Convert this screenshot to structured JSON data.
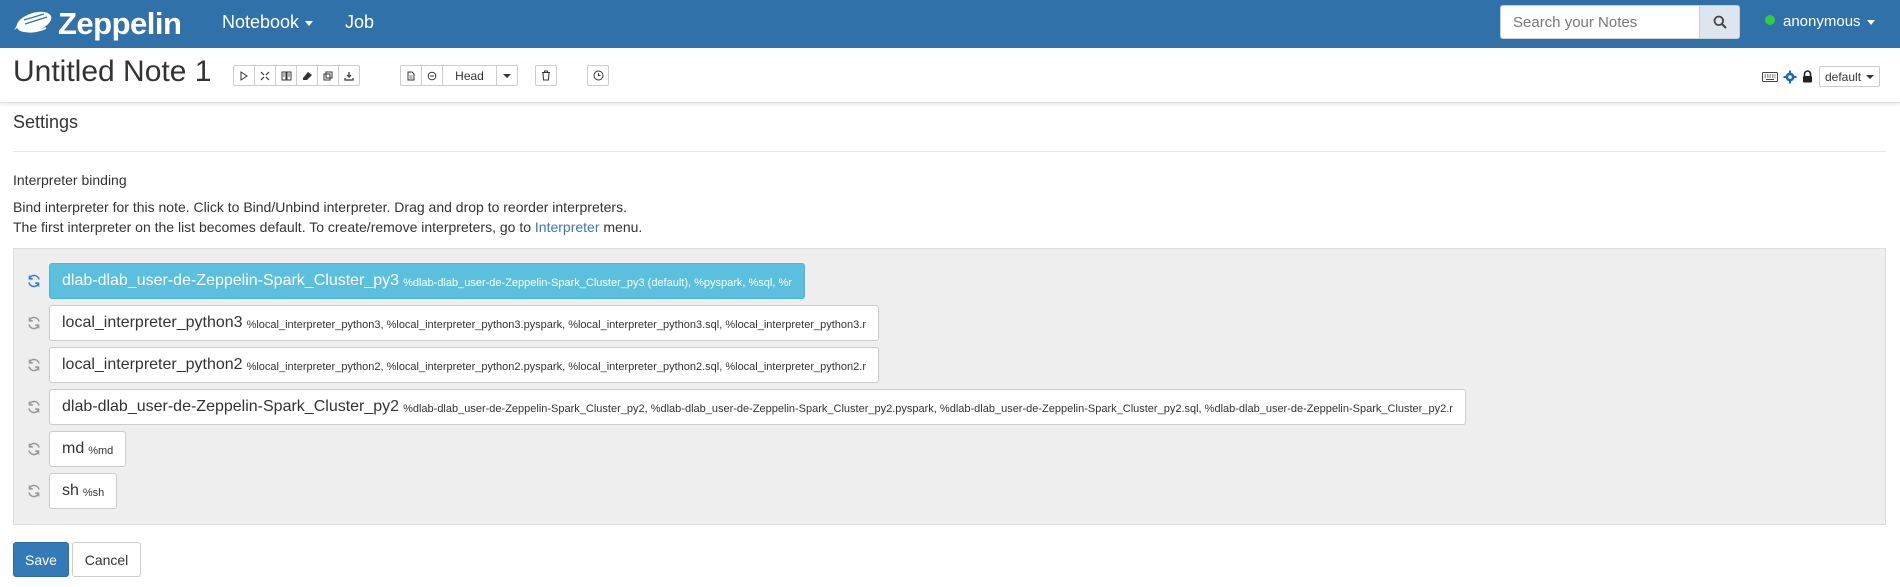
{
  "navbar": {
    "brand": "Zeppelin",
    "menu": [
      {
        "label": "Notebook",
        "has_dropdown": true
      },
      {
        "label": "Job",
        "has_dropdown": false
      }
    ],
    "search_placeholder": "Search your Notes",
    "user": "anonymous",
    "user_status_color": "#2ecc40",
    "bg_color": "#3071a9"
  },
  "note": {
    "title": "Untitled Note 1",
    "toolbar_icons": [
      "run-all-icon",
      "show-hide-code-icon",
      "show-hide-output-icon",
      "clear-output-icon",
      "clone-icon",
      "export-icon"
    ],
    "version_icons": [
      "commit-icon",
      "revision-compare-icon"
    ],
    "version_label": "Head",
    "delete_icon": "trash-icon",
    "scheduler_icon": "clock-icon",
    "right_icons": [
      "keyboard-icon",
      "gear-icon",
      "lock-icon"
    ],
    "mode_label": "default"
  },
  "settings": {
    "title": "Settings",
    "binding_title": "Interpreter binding",
    "desc_line1": "Bind interpreter for this note. Click to Bind/Unbind interpreter. Drag and drop to reorder interpreters.",
    "desc_line2_pre": "The first interpreter on the list becomes default. To create/remove interpreters, go to ",
    "desc_line2_link": "Interpreter",
    "desc_line2_post": " menu.",
    "interpreters": [
      {
        "name": "dlab-dlab_user-de-Zeppelin-Spark_Cluster_py3",
        "aliases": "%dlab-dlab_user-de-Zeppelin-Spark_Cluster_py3 (default), %pyspark, %sql, %r",
        "selected": true
      },
      {
        "name": "local_interpreter_python3",
        "aliases": "%local_interpreter_python3, %local_interpreter_python3.pyspark, %local_interpreter_python3.sql, %local_interpreter_python3.r",
        "selected": false
      },
      {
        "name": "local_interpreter_python2",
        "aliases": "%local_interpreter_python2, %local_interpreter_python2.pyspark, %local_interpreter_python2.sql, %local_interpreter_python2.r",
        "selected": false
      },
      {
        "name": "dlab-dlab_user-de-Zeppelin-Spark_Cluster_py2",
        "aliases": "%dlab-dlab_user-de-Zeppelin-Spark_Cluster_py2, %dlab-dlab_user-de-Zeppelin-Spark_Cluster_py2.pyspark, %dlab-dlab_user-de-Zeppelin-Spark_Cluster_py2.sql, %dlab-dlab_user-de-Zeppelin-Spark_Cluster_py2.r",
        "selected": false
      },
      {
        "name": "md",
        "aliases": "%md",
        "selected": false
      },
      {
        "name": "sh",
        "aliases": "%sh",
        "selected": false
      }
    ],
    "selected_color": "#5bc0de",
    "save_label": "Save",
    "cancel_label": "Cancel"
  }
}
